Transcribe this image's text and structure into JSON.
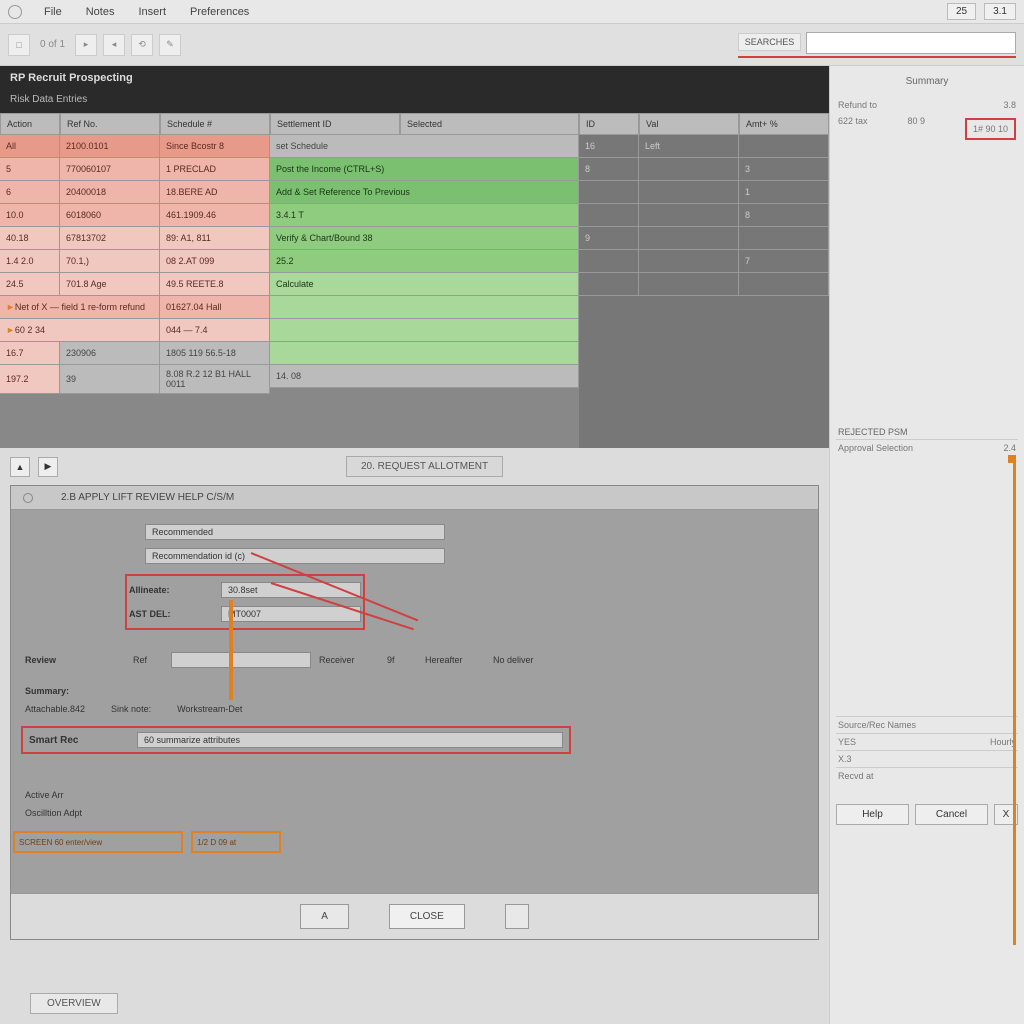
{
  "menu": {
    "items": [
      "File",
      "Notes",
      "Insert",
      "Preferences"
    ],
    "right1": "25",
    "right2": "3.1"
  },
  "toolbar": {
    "labels": [
      "0 of 1"
    ],
    "search_label": "SEARCHES",
    "search_value": ""
  },
  "panel": {
    "title": "RP Recruit Prospecting",
    "subtitle": "Risk Data Entries"
  },
  "grid": {
    "headers_left": [
      "Action",
      "Ref No.",
      "Schedule #"
    ],
    "headers_mid": [
      "Settlement ID"
    ],
    "headers_mid2": [
      "Selected"
    ],
    "rows_left": [
      {
        "c1": "All",
        "c2": "2100.0101",
        "c3": "Since Bcostr 8",
        "color": "red-300"
      },
      {
        "c1": "5",
        "c2": "770060107",
        "c3": "1 PRECLAD",
        "color": "red-200"
      },
      {
        "c1": "6",
        "c2": "20400018",
        "c3": "18.BERE AD",
        "color": "red-200"
      },
      {
        "c1": "10.0",
        "c2": "6018060",
        "c3": "461.1909.46",
        "color": "red-200"
      },
      {
        "c1": "40.18",
        "c2": "67813702",
        "c3": "89: A1, 811",
        "color": "red-100"
      },
      {
        "c1": "1.4 2.0",
        "c2": "70.1,)",
        "c3": "08 2.AT 099",
        "color": "red-100"
      },
      {
        "c1": "24.5",
        "c2": "701.8 Age",
        "c3": "49.5 REETE.8",
        "color": "red-100"
      }
    ],
    "span_rows": [
      {
        "text": "Net of X — field 1 re-form refund",
        "c3": "01627.04 Hall",
        "color": "red-200"
      },
      {
        "text": "60 2  34 ",
        "c2": "044 — 7.4",
        "color": "red-100"
      }
    ],
    "footer_rows": [
      {
        "c1": "16.7",
        "c2": "230906",
        "c3": "1805 119 56.5-18"
      },
      {
        "c1": "197.2",
        "c2": "39",
        "c3": "8.08 R.2  12 B1 HALL 0011"
      }
    ],
    "mid_col": [
      {
        "text": "set Schedule",
        "color": "gray"
      },
      {
        "text": "Post the Income (CTRL+S)",
        "color": "green-400"
      },
      {
        "text": "Add & Set Reference To Previous",
        "color": "green-400"
      },
      {
        "text": "3.4.1 T",
        "color": "green-300"
      },
      {
        "text": "Verify & Chart/Bound 38",
        "color": "green-300"
      },
      {
        "text": "25.2",
        "color": "green-300"
      },
      {
        "text": "Calculate",
        "color": "green-200"
      },
      {
        "text": "",
        "color": "green-200"
      },
      {
        "text": "",
        "color": "green-200"
      },
      {
        "text": "",
        "color": "green-200"
      },
      {
        "text": "14. 08",
        "color": "gray"
      }
    ],
    "right_headers": [
      "ID",
      "Val",
      "Amt+ %"
    ],
    "right_rows": [
      {
        "c1": "16",
        "c2": "Left",
        "c3": ""
      },
      {
        "c1": "8",
        "c2": "",
        "c3": "3"
      },
      {
        "c1": "",
        "c2": "",
        "c3": "1"
      },
      {
        "c1": "",
        "c2": "",
        "c3": "8"
      },
      {
        "c1": "9",
        "c2": "",
        "c3": ""
      },
      {
        "c1": "",
        "c2": "",
        "c3": "7"
      },
      {
        "c1": "",
        "c2": "",
        "c3": ""
      }
    ]
  },
  "center_button": "20. REQUEST ALLOTMENT",
  "right_panel": {
    "header": "Summary",
    "rows": [
      {
        "k": "Refund to",
        "v": "3.8"
      },
      {
        "k": "622 tax",
        "v": "80 9"
      }
    ],
    "highlight": "1# 90 10",
    "section2_label": "REJECTED  PSM",
    "section2_rows": [
      {
        "k": "Approval Selection",
        "v": "2.4"
      }
    ]
  },
  "lower": {
    "title": "2.B  APPLY  LIFT  REVIEW  HELP  C/S/M",
    "fields": [
      {
        "label": "",
        "value": "Recommended"
      },
      {
        "label": "",
        "value": "Recommendation id (c)"
      },
      {
        "label": "Allineate:",
        "short": "30.8set"
      },
      {
        "label": "AST DEL:",
        "short": "MT0007"
      }
    ],
    "midrow_labels": [
      "Review",
      "Ref",
      "",
      "Receiver",
      "9f",
      "Hereafter",
      "No deliver"
    ],
    "summary_label": "Summary:",
    "detail_labels": [
      "Attachable.842",
      "Sink  note:",
      "Workstream-Det"
    ],
    "longfield_label": "Smart Rec",
    "longfield_value": "60   summarize attributes",
    "bottom_labels": [
      "Active Arr",
      "Oscilltion Adpt"
    ],
    "bottom_box1": "SCREEN 60 enter/view",
    "bottom_box2": "1/2 D 09 at"
  },
  "right_detail": {
    "rows": [
      {
        "k": "Source/Rec Names",
        "v": ""
      },
      {
        "k": "YES",
        "v": "Hourly"
      },
      {
        "k": "X.3",
        "v": ""
      },
      {
        "k": "Recvd at",
        "v": ""
      }
    ]
  },
  "buttons": {
    "footer_left": "OVERVIEW",
    "lower_ok": "Help",
    "lower_cancel": "Cancel",
    "lower_close": "X",
    "lower_other": ""
  },
  "dialog_buttons": {
    "b1": "A",
    "b2": "CLOSE"
  }
}
